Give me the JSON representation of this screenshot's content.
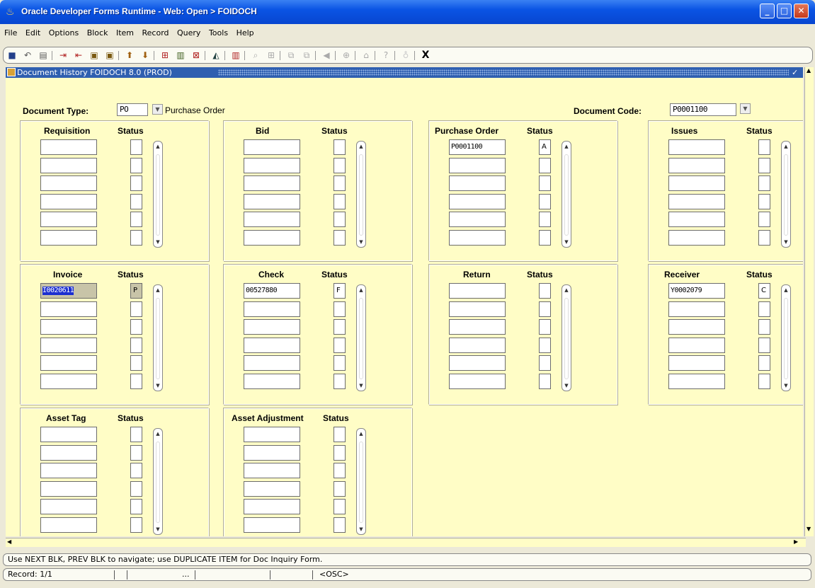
{
  "window": {
    "title": "Oracle Developer Forms Runtime - Web:  Open > FOIDOCH"
  },
  "menu": [
    "File",
    "Edit",
    "Options",
    "Block",
    "Item",
    "Record",
    "Query",
    "Tools",
    "Help"
  ],
  "toolbar": {
    "exit_label": "X"
  },
  "form": {
    "title": "Document History  FOIDOCH  8.0  (PROD)"
  },
  "header": {
    "doc_type_label": "Document Type:",
    "doc_type_value": "PO",
    "doc_type_desc": "Purchase Order",
    "doc_code_label": "Document Code:",
    "doc_code_value": "P0001100"
  },
  "status_header": "Status",
  "blocks": [
    {
      "title": "Requisition",
      "rows": [
        [
          "",
          ""
        ],
        [
          "",
          ""
        ],
        [
          "",
          ""
        ],
        [
          "",
          ""
        ],
        [
          "",
          ""
        ],
        [
          "",
          ""
        ]
      ]
    },
    {
      "title": "Bid",
      "rows": [
        [
          "",
          ""
        ],
        [
          "",
          ""
        ],
        [
          "",
          ""
        ],
        [
          "",
          ""
        ],
        [
          "",
          ""
        ],
        [
          "",
          ""
        ]
      ]
    },
    {
      "title": "Purchase Order",
      "rows": [
        [
          "P0001100",
          "A"
        ],
        [
          "",
          ""
        ],
        [
          "",
          ""
        ],
        [
          "",
          ""
        ],
        [
          "",
          ""
        ],
        [
          "",
          ""
        ]
      ]
    },
    {
      "title": "Issues",
      "rows": [
        [
          "",
          ""
        ],
        [
          "",
          ""
        ],
        [
          "",
          ""
        ],
        [
          "",
          ""
        ],
        [
          "",
          ""
        ],
        [
          "",
          ""
        ]
      ]
    },
    {
      "title": "Invoice",
      "rows": [
        [
          "I0020611",
          "P"
        ],
        [
          "",
          ""
        ],
        [
          "",
          ""
        ],
        [
          "",
          ""
        ],
        [
          "",
          ""
        ],
        [
          "",
          ""
        ]
      ]
    },
    {
      "title": "Check",
      "rows": [
        [
          "00527880",
          "F"
        ],
        [
          "",
          ""
        ],
        [
          "",
          ""
        ],
        [
          "",
          ""
        ],
        [
          "",
          ""
        ],
        [
          "",
          ""
        ]
      ]
    },
    {
      "title": "Return",
      "rows": [
        [
          "",
          ""
        ],
        [
          "",
          ""
        ],
        [
          "",
          ""
        ],
        [
          "",
          ""
        ],
        [
          "",
          ""
        ],
        [
          "",
          ""
        ]
      ]
    },
    {
      "title": "Receiver",
      "rows": [
        [
          "Y0002079",
          "C"
        ],
        [
          "",
          ""
        ],
        [
          "",
          ""
        ],
        [
          "",
          ""
        ],
        [
          "",
          ""
        ],
        [
          "",
          ""
        ]
      ]
    },
    {
      "title": "Asset Tag",
      "rows": [
        [
          "",
          ""
        ],
        [
          "",
          ""
        ],
        [
          "",
          ""
        ],
        [
          "",
          ""
        ],
        [
          "",
          ""
        ],
        [
          "",
          ""
        ]
      ]
    },
    {
      "title": "Asset Adjustment",
      "rows": [
        [
          "",
          ""
        ],
        [
          "",
          ""
        ],
        [
          "",
          ""
        ],
        [
          "",
          ""
        ],
        [
          "",
          ""
        ],
        [
          "",
          ""
        ]
      ]
    }
  ],
  "statusbar": {
    "message": "Use NEXT BLK, PREV BLK to navigate; use DUPLICATE ITEM for Doc Inquiry Form."
  },
  "recordbar": {
    "record": "Record: 1/1",
    "ellipsis": "...",
    "mode": "<OSC>"
  },
  "colors": {
    "canvas": "#fffdc6",
    "titlebar": "#0a54e4",
    "formbar": "#2f5fb0",
    "selected": "#1c2fd0"
  }
}
